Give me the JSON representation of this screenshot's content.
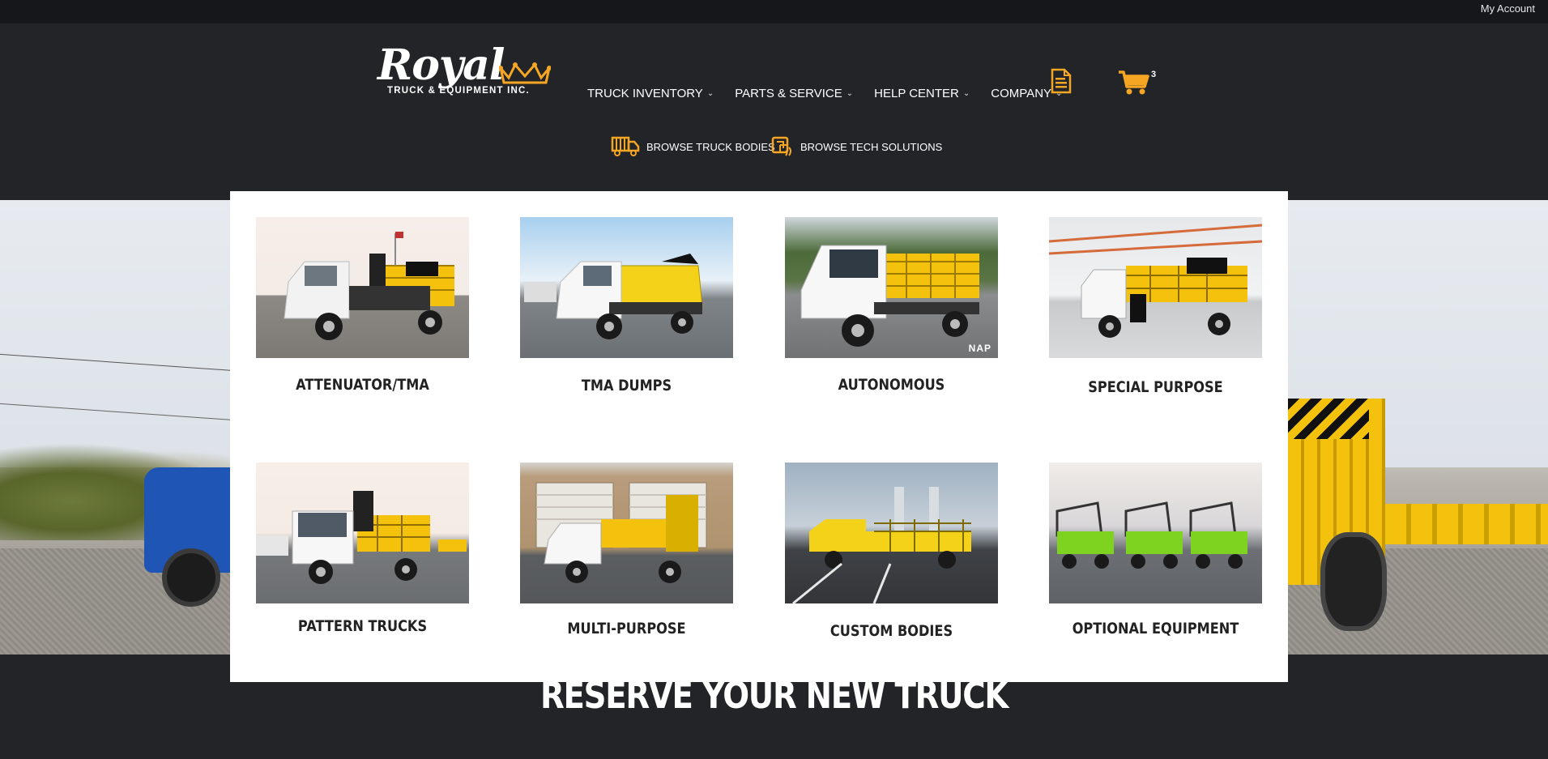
{
  "topbar": {
    "account_label": "My Account"
  },
  "logo": {
    "script": "Royal",
    "subtitle": "TRUCK & EQUIPMENT INC."
  },
  "nav": {
    "items": [
      {
        "label": "TRUCK INVENTORY"
      },
      {
        "label": "PARTS & SERVICE"
      },
      {
        "label": "HELP CENTER"
      },
      {
        "label": "COMPANY"
      }
    ],
    "cart_count": "3"
  },
  "browse": {
    "bodies_label": "BROWSE TRUCK BODIES",
    "tech_label": "BROWSE TECH SOLUTIONS"
  },
  "menu": {
    "cards": [
      {
        "label": "ATTENUATOR/TMA",
        "image": "white-truck-attenuator-photo"
      },
      {
        "label": "TMA DUMPS",
        "image": "white-yellow-dump-truck-photo"
      },
      {
        "label": "AUTONOMOUS",
        "image": "white-autonomous-truck-photo",
        "badge": "NAP"
      },
      {
        "label": "SPECIAL PURPOSE",
        "image": "warehouse-truck-photo"
      },
      {
        "label": "PATTERN TRUCKS",
        "image": "white-pattern-truck-photo"
      },
      {
        "label": "MULTI-PURPOSE",
        "image": "garage-multipurpose-truck-photo"
      },
      {
        "label": "CUSTOM BODIES",
        "image": "yellow-custom-body-truck-photo"
      },
      {
        "label": "OPTIONAL EQUIPMENT",
        "image": "green-trucks-row-photo"
      }
    ]
  },
  "section": {
    "title": "RESERVE YOUR NEW TRUCK"
  },
  "colors": {
    "accent": "#f5a623",
    "header_bg": "#222428",
    "topbar_bg": "#16171a"
  }
}
